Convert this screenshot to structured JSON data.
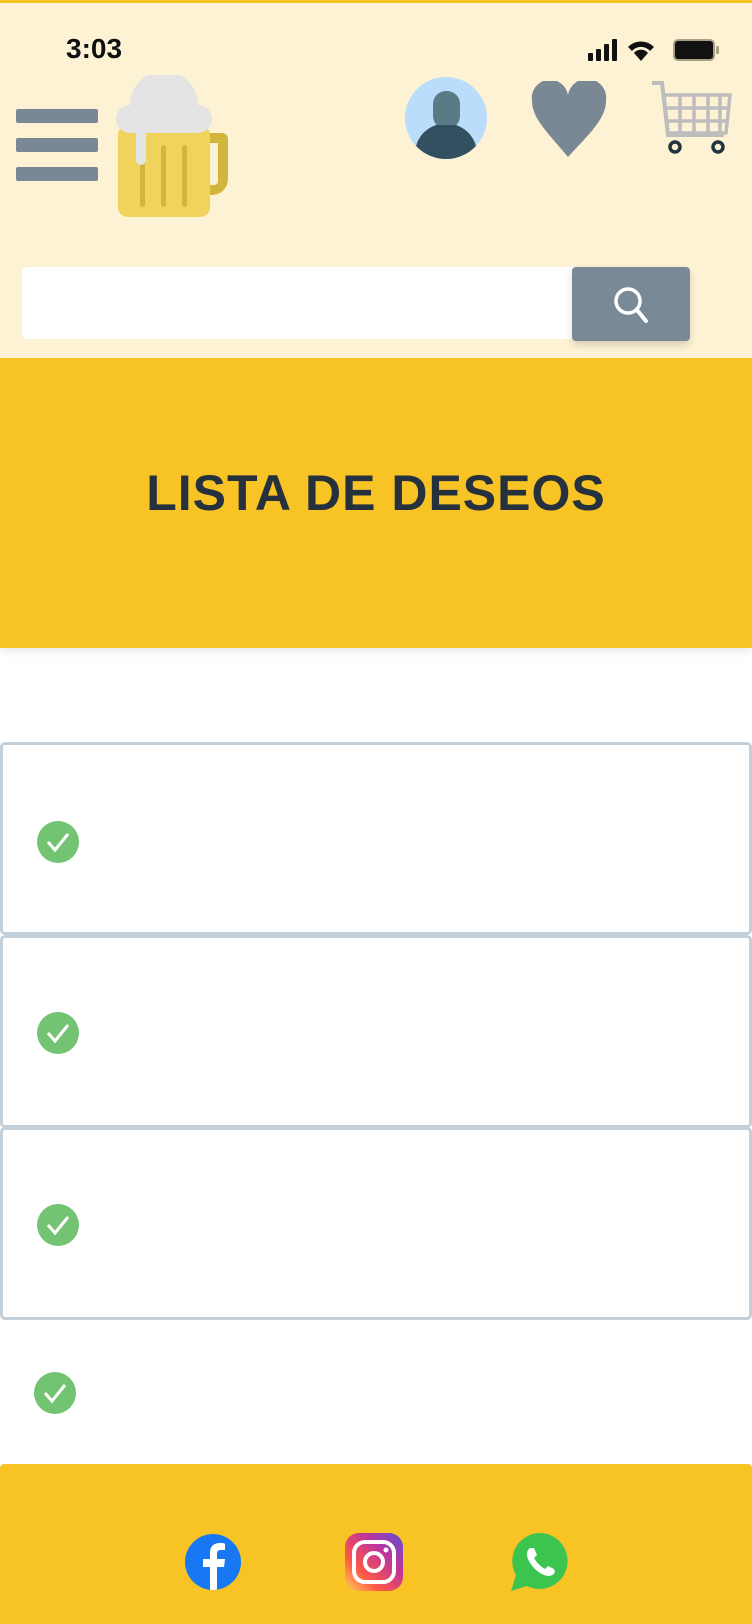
{
  "status_bar": {
    "time": "3:03"
  },
  "header": {
    "menu_icon": "hamburger-icon",
    "logo_icon": "beer-mug-icon",
    "account_icon": "user-avatar-icon",
    "wishlist_icon": "heart-icon",
    "cart_icon": "shopping-cart-icon",
    "search": {
      "value": "",
      "placeholder": "",
      "button_icon": "search-icon"
    }
  },
  "banner": {
    "title": "LISTA DE DESEOS"
  },
  "wishlist": {
    "items": [
      {
        "icon": "check-circle-icon",
        "label": ""
      },
      {
        "icon": "check-circle-icon",
        "label": ""
      },
      {
        "icon": "check-circle-icon",
        "label": ""
      },
      {
        "icon": "check-circle-icon",
        "label": ""
      }
    ]
  },
  "footer": {
    "social": [
      "facebook-icon",
      "instagram-icon",
      "whatsapp-icon"
    ]
  },
  "colors": {
    "header_bg": "#fdf2d4",
    "accent": "#f7c325",
    "title": "#25313d",
    "icon_gray": "#7a8896",
    "check": "#72c473"
  }
}
